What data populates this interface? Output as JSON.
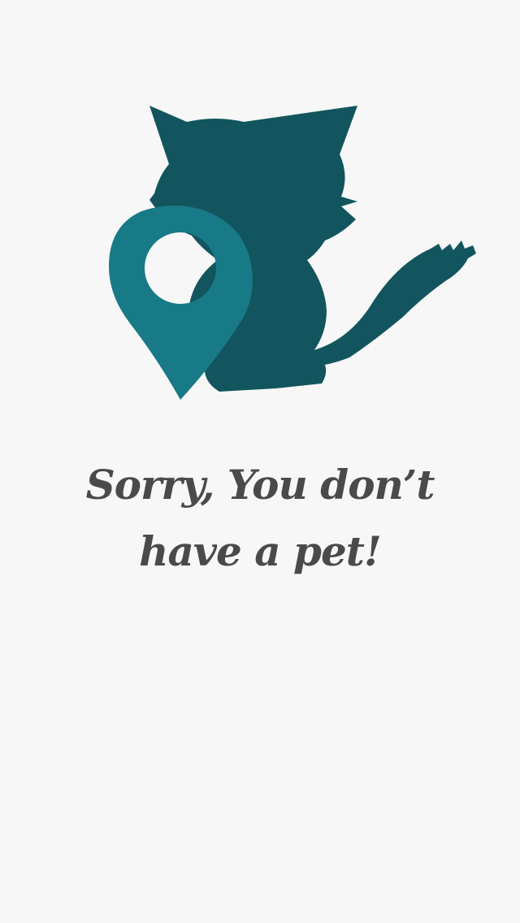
{
  "empty_state": {
    "illustration_icon": "cat-with-location-pin-icon",
    "message_line1": "Sorry, You don’t",
    "message_line2": "have a pet!"
  },
  "colors": {
    "background": "#f7f7f7",
    "cat": "#12555e",
    "pin": "#187a86",
    "text": "#4a4a4a"
  }
}
